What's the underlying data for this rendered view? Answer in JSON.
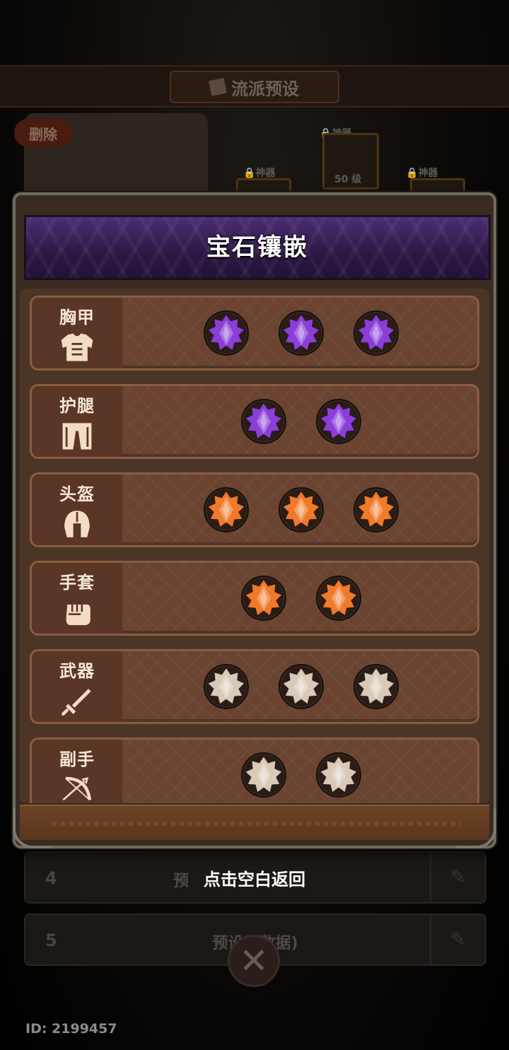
{
  "background": {
    "header_title": "流派预设",
    "delete_label": "删除",
    "slot_labels": [
      "神器",
      "神器",
      "神器"
    ],
    "level_label": "50 级",
    "preset_rows": [
      {
        "num": "4",
        "text": "预"
      },
      {
        "num": "5",
        "text": "预设5     数据)"
      }
    ]
  },
  "modal": {
    "title": "宝石镶嵌",
    "rows": [
      {
        "slot": "胸甲",
        "icon": "chest-armor-icon",
        "gem_color": "purple",
        "gem_count": 3
      },
      {
        "slot": "护腿",
        "icon": "leg-armor-icon",
        "gem_color": "purple",
        "gem_count": 2
      },
      {
        "slot": "头盔",
        "icon": "helmet-icon",
        "gem_color": "orange",
        "gem_count": 3
      },
      {
        "slot": "手套",
        "icon": "fist-icon",
        "gem_color": "orange",
        "gem_count": 2
      },
      {
        "slot": "武器",
        "icon": "sword-icon",
        "gem_color": "white",
        "gem_count": 3
      },
      {
        "slot": "副手",
        "icon": "bow-icon",
        "gem_color": "white",
        "gem_count": 2
      }
    ]
  },
  "hint": "点击空白返回",
  "player_id": "ID: 2199457",
  "colors": {
    "purple": "#8b3fd8",
    "orange": "#f07a2a",
    "white": "#d8cab6",
    "header": "#3b2260"
  }
}
